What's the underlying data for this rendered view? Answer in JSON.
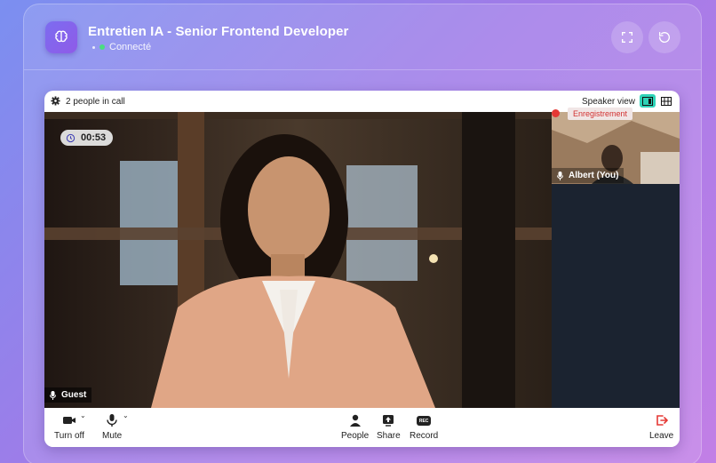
{
  "header": {
    "title": "Entretien IA - Senior Frontend Developer",
    "status": "Connecté",
    "colors": {
      "status_dot": "#4ade80",
      "logo_bg": "#7c6cf0"
    },
    "icons": {
      "logo": "brain-icon",
      "fullscreen": "fullscreen-icon",
      "refresh": "refresh-icon"
    }
  },
  "call": {
    "people_count": "2 people in call",
    "view_label": "Speaker view",
    "timer": "00:53",
    "main_participant": "Guest",
    "self_participant": "Albert (You)",
    "recording_label": "Enregistrement",
    "colors": {
      "view_active": "#2ed3b7",
      "recording": "#e53935",
      "leave": "#e53935"
    }
  },
  "controls": {
    "camera": "Turn off",
    "mic": "Mute",
    "people": "People",
    "share": "Share",
    "record": "Record",
    "record_badge": "REC",
    "leave": "Leave"
  }
}
